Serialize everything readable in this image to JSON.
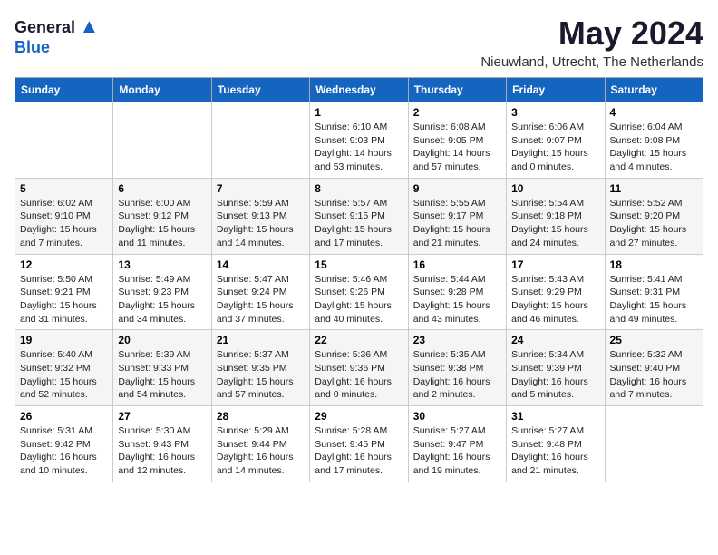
{
  "logo": {
    "general": "General",
    "blue": "Blue"
  },
  "title": {
    "month_year": "May 2024",
    "location": "Nieuwland, Utrecht, The Netherlands"
  },
  "weekdays": [
    "Sunday",
    "Monday",
    "Tuesday",
    "Wednesday",
    "Thursday",
    "Friday",
    "Saturday"
  ],
  "weeks": [
    [
      {
        "day": "",
        "info": ""
      },
      {
        "day": "",
        "info": ""
      },
      {
        "day": "",
        "info": ""
      },
      {
        "day": "1",
        "info": "Sunrise: 6:10 AM\nSunset: 9:03 PM\nDaylight: 14 hours and 53 minutes."
      },
      {
        "day": "2",
        "info": "Sunrise: 6:08 AM\nSunset: 9:05 PM\nDaylight: 14 hours and 57 minutes."
      },
      {
        "day": "3",
        "info": "Sunrise: 6:06 AM\nSunset: 9:07 PM\nDaylight: 15 hours and 0 minutes."
      },
      {
        "day": "4",
        "info": "Sunrise: 6:04 AM\nSunset: 9:08 PM\nDaylight: 15 hours and 4 minutes."
      }
    ],
    [
      {
        "day": "5",
        "info": "Sunrise: 6:02 AM\nSunset: 9:10 PM\nDaylight: 15 hours and 7 minutes."
      },
      {
        "day": "6",
        "info": "Sunrise: 6:00 AM\nSunset: 9:12 PM\nDaylight: 15 hours and 11 minutes."
      },
      {
        "day": "7",
        "info": "Sunrise: 5:59 AM\nSunset: 9:13 PM\nDaylight: 15 hours and 14 minutes."
      },
      {
        "day": "8",
        "info": "Sunrise: 5:57 AM\nSunset: 9:15 PM\nDaylight: 15 hours and 17 minutes."
      },
      {
        "day": "9",
        "info": "Sunrise: 5:55 AM\nSunset: 9:17 PM\nDaylight: 15 hours and 21 minutes."
      },
      {
        "day": "10",
        "info": "Sunrise: 5:54 AM\nSunset: 9:18 PM\nDaylight: 15 hours and 24 minutes."
      },
      {
        "day": "11",
        "info": "Sunrise: 5:52 AM\nSunset: 9:20 PM\nDaylight: 15 hours and 27 minutes."
      }
    ],
    [
      {
        "day": "12",
        "info": "Sunrise: 5:50 AM\nSunset: 9:21 PM\nDaylight: 15 hours and 31 minutes."
      },
      {
        "day": "13",
        "info": "Sunrise: 5:49 AM\nSunset: 9:23 PM\nDaylight: 15 hours and 34 minutes."
      },
      {
        "day": "14",
        "info": "Sunrise: 5:47 AM\nSunset: 9:24 PM\nDaylight: 15 hours and 37 minutes."
      },
      {
        "day": "15",
        "info": "Sunrise: 5:46 AM\nSunset: 9:26 PM\nDaylight: 15 hours and 40 minutes."
      },
      {
        "day": "16",
        "info": "Sunrise: 5:44 AM\nSunset: 9:28 PM\nDaylight: 15 hours and 43 minutes."
      },
      {
        "day": "17",
        "info": "Sunrise: 5:43 AM\nSunset: 9:29 PM\nDaylight: 15 hours and 46 minutes."
      },
      {
        "day": "18",
        "info": "Sunrise: 5:41 AM\nSunset: 9:31 PM\nDaylight: 15 hours and 49 minutes."
      }
    ],
    [
      {
        "day": "19",
        "info": "Sunrise: 5:40 AM\nSunset: 9:32 PM\nDaylight: 15 hours and 52 minutes."
      },
      {
        "day": "20",
        "info": "Sunrise: 5:39 AM\nSunset: 9:33 PM\nDaylight: 15 hours and 54 minutes."
      },
      {
        "day": "21",
        "info": "Sunrise: 5:37 AM\nSunset: 9:35 PM\nDaylight: 15 hours and 57 minutes."
      },
      {
        "day": "22",
        "info": "Sunrise: 5:36 AM\nSunset: 9:36 PM\nDaylight: 16 hours and 0 minutes."
      },
      {
        "day": "23",
        "info": "Sunrise: 5:35 AM\nSunset: 9:38 PM\nDaylight: 16 hours and 2 minutes."
      },
      {
        "day": "24",
        "info": "Sunrise: 5:34 AM\nSunset: 9:39 PM\nDaylight: 16 hours and 5 minutes."
      },
      {
        "day": "25",
        "info": "Sunrise: 5:32 AM\nSunset: 9:40 PM\nDaylight: 16 hours and 7 minutes."
      }
    ],
    [
      {
        "day": "26",
        "info": "Sunrise: 5:31 AM\nSunset: 9:42 PM\nDaylight: 16 hours and 10 minutes."
      },
      {
        "day": "27",
        "info": "Sunrise: 5:30 AM\nSunset: 9:43 PM\nDaylight: 16 hours and 12 minutes."
      },
      {
        "day": "28",
        "info": "Sunrise: 5:29 AM\nSunset: 9:44 PM\nDaylight: 16 hours and 14 minutes."
      },
      {
        "day": "29",
        "info": "Sunrise: 5:28 AM\nSunset: 9:45 PM\nDaylight: 16 hours and 17 minutes."
      },
      {
        "day": "30",
        "info": "Sunrise: 5:27 AM\nSunset: 9:47 PM\nDaylight: 16 hours and 19 minutes."
      },
      {
        "day": "31",
        "info": "Sunrise: 5:27 AM\nSunset: 9:48 PM\nDaylight: 16 hours and 21 minutes."
      },
      {
        "day": "",
        "info": ""
      }
    ]
  ]
}
